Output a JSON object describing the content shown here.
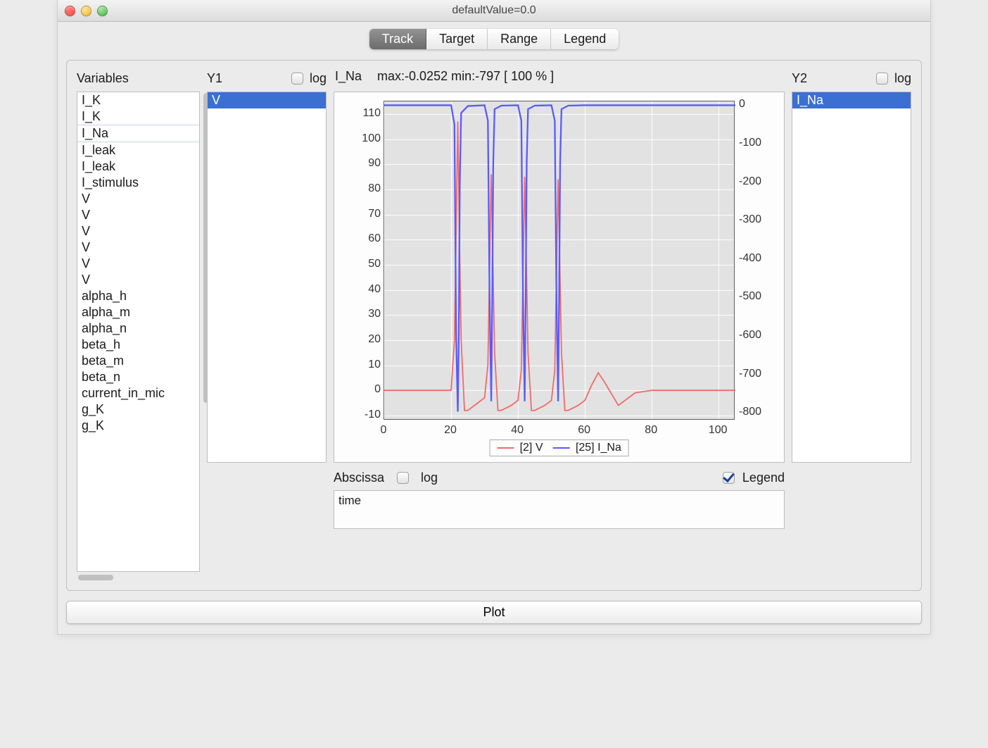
{
  "window": {
    "title": "defaultValue=0.0"
  },
  "tabs": {
    "items": [
      {
        "label": "Track",
        "active": true
      },
      {
        "label": "Target",
        "active": false
      },
      {
        "label": "Range",
        "active": false
      },
      {
        "label": "Legend",
        "active": false
      }
    ]
  },
  "variables": {
    "label": "Variables",
    "items": [
      "I_K",
      "I_K",
      "I_Na",
      "I_leak",
      "I_leak",
      "I_stimulus",
      "V",
      "V",
      "V",
      "V",
      "V",
      "V",
      "alpha_h",
      "alpha_m",
      "alpha_n",
      "beta_h",
      "beta_m",
      "beta_n",
      "current_in_mic",
      "g_K",
      "g_K"
    ],
    "selected_index": 2
  },
  "y1": {
    "label": "Y1",
    "log_label": "log",
    "log_checked": false,
    "items": [
      "V"
    ],
    "selected_index": 0
  },
  "y2": {
    "label": "Y2",
    "log_label": "log",
    "log_checked": false,
    "items": [
      "I_Na"
    ],
    "selected_index": 0
  },
  "abscissa": {
    "label": "Abscissa",
    "log_label": "log",
    "log_checked": false,
    "legend_label": "Legend",
    "legend_checked": true,
    "value": "time"
  },
  "plot_button": "Plot",
  "chart_header": {
    "variable": "I_Na",
    "stats": "max:-0.0252 min:-797 [ 100 % ]"
  },
  "chart_data": {
    "type": "line",
    "xlabel": "",
    "x_ticks": [
      0,
      20,
      40,
      60,
      80,
      100
    ],
    "y1_label": "",
    "y1_ticks": [
      -10,
      0,
      10,
      20,
      30,
      40,
      50,
      60,
      70,
      80,
      90,
      100,
      110
    ],
    "y2_label": "",
    "y2_ticks": [
      0,
      -100,
      -200,
      -300,
      -400,
      -500,
      -600,
      -700,
      -800
    ],
    "xlim": [
      0,
      105
    ],
    "y1lim": [
      -12,
      115
    ],
    "y2lim": [
      -820,
      10
    ],
    "series": [
      {
        "name": "[2] V",
        "axis": "y1",
        "color": "#f26b6b",
        "x": [
          0,
          10,
          20,
          21,
          22,
          22.5,
          23,
          24,
          25,
          28,
          30,
          31,
          32,
          32.5,
          33,
          34,
          35,
          38,
          40,
          41,
          42,
          42.5,
          43,
          44,
          45,
          48,
          50,
          51,
          52,
          52.5,
          53,
          54,
          55,
          58,
          60,
          62,
          64,
          66,
          70,
          75,
          80,
          85,
          90,
          95,
          100,
          105
        ],
        "values": [
          0,
          0,
          0,
          20,
          107,
          60,
          20,
          -8,
          -8,
          -5,
          -3,
          10,
          86,
          50,
          15,
          -8,
          -8,
          -6,
          -4,
          8,
          85,
          50,
          15,
          -8,
          -8,
          -6,
          -4,
          8,
          84,
          50,
          15,
          -8,
          -8,
          -6,
          -4,
          2,
          7,
          3,
          -6,
          -1,
          0,
          0,
          0,
          0,
          0,
          0
        ]
      },
      {
        "name": "[25] I_Na",
        "axis": "y2",
        "color": "#5a5aff",
        "x": [
          0,
          10,
          20,
          21,
          21.5,
          22,
          22.3,
          22.6,
          23,
          25,
          30,
          31,
          31.5,
          32,
          32.3,
          32.6,
          33,
          35,
          40,
          41,
          41.5,
          42,
          42.3,
          42.6,
          43,
          45,
          50,
          51,
          51.5,
          52,
          52.3,
          52.6,
          53,
          55,
          60,
          70,
          80,
          90,
          100,
          105
        ],
        "values": [
          0,
          0,
          0,
          -50,
          -600,
          -797,
          -600,
          -200,
          -20,
          -2,
          0,
          -40,
          -500,
          -770,
          -500,
          -150,
          -10,
          -1,
          0,
          -40,
          -500,
          -770,
          -500,
          -150,
          -10,
          -1,
          0,
          -40,
          -500,
          -770,
          -500,
          -150,
          -10,
          -1,
          0,
          0,
          0,
          0,
          0,
          0
        ]
      }
    ],
    "legend": [
      "[2] V",
      "[25] I_Na"
    ]
  }
}
